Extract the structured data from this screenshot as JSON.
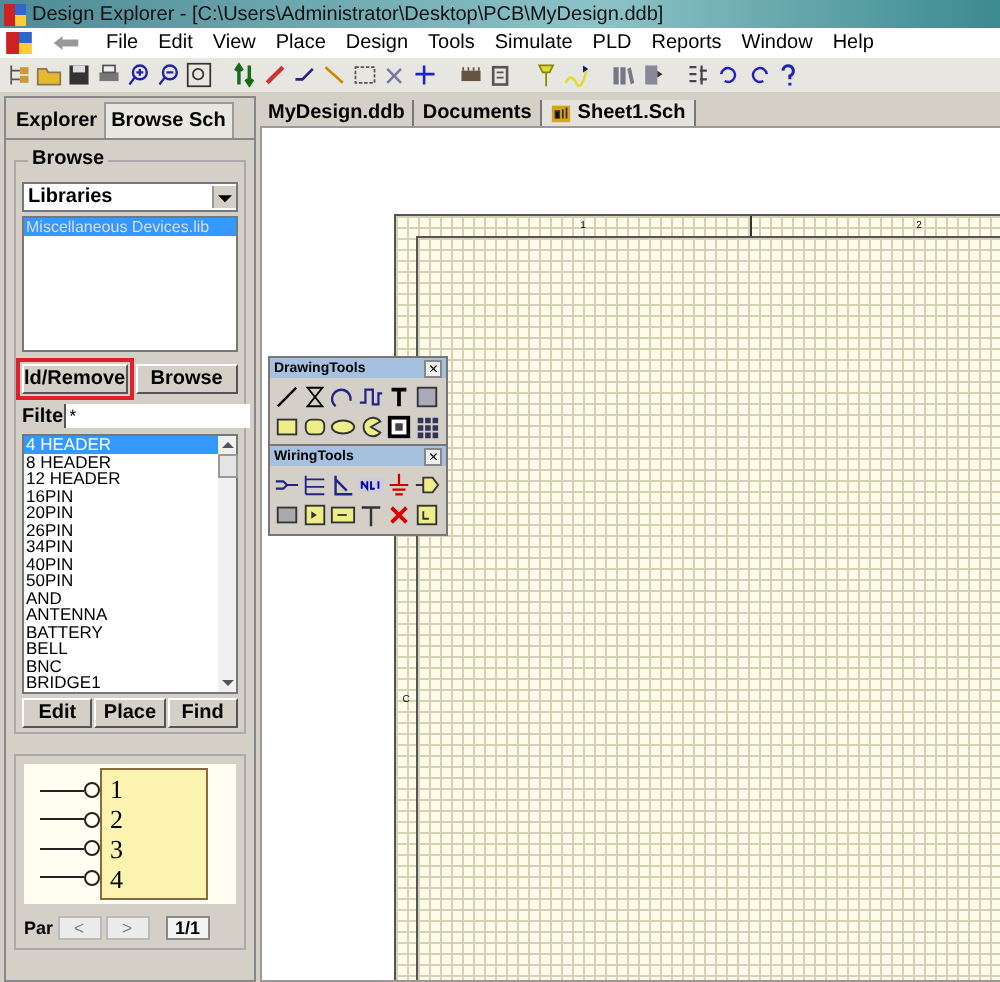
{
  "window": {
    "title": "Design Explorer - [C:\\Users\\Administrator\\Desktop\\PCB\\MyDesign.ddb]"
  },
  "menu": [
    "File",
    "Edit",
    "View",
    "Place",
    "Design",
    "Tools",
    "Simulate",
    "PLD",
    "Reports",
    "Window",
    "Help"
  ],
  "panel_tabs": [
    {
      "label": "Explorer",
      "selected": false
    },
    {
      "label": "Browse Sch",
      "selected": true
    }
  ],
  "browse": {
    "title": "Browse",
    "dropdown": "Libraries",
    "libraries": [
      {
        "label": "Miscellaneous Devices.lib",
        "selected": true
      }
    ],
    "buttons": [
      {
        "label": "ld/Remove",
        "highlighted": true
      },
      {
        "label": "Browse",
        "highlighted": false
      }
    ],
    "filter_label": "Filte",
    "filter_value": "*",
    "components": [
      {
        "label": "4 HEADER",
        "selected": true
      },
      {
        "label": "8 HEADER",
        "selected": false
      },
      {
        "label": "12 HEADER",
        "selected": false
      },
      {
        "label": "16PIN",
        "selected": false
      },
      {
        "label": "20PIN",
        "selected": false
      },
      {
        "label": "26PIN",
        "selected": false
      },
      {
        "label": "34PIN",
        "selected": false
      },
      {
        "label": "40PIN",
        "selected": false
      },
      {
        "label": "50PIN",
        "selected": false
      },
      {
        "label": "AND",
        "selected": false
      },
      {
        "label": "ANTENNA",
        "selected": false
      },
      {
        "label": "BATTERY",
        "selected": false
      },
      {
        "label": "BELL",
        "selected": false
      },
      {
        "label": "BNC",
        "selected": false
      },
      {
        "label": "BRIDGE1",
        "selected": false
      }
    ],
    "component_buttons": [
      "Edit",
      "Place",
      "Find"
    ]
  },
  "preview": {
    "pins": [
      "1",
      "2",
      "3",
      "4"
    ],
    "part_label": "Par",
    "prev": "<",
    "next": ">",
    "page": "1/1"
  },
  "doc_tabs": [
    {
      "label": "MyDesign.ddb",
      "selected": false,
      "icon": false
    },
    {
      "label": "Documents",
      "selected": false,
      "icon": false
    },
    {
      "label": "Sheet1.Sch",
      "selected": true,
      "icon": true
    }
  ],
  "sheet": {
    "column_marks": [
      "1",
      "2"
    ],
    "row_mark": "C"
  },
  "floating_toolbars": [
    {
      "title": "DrawingTools",
      "close": "×",
      "kind": "drawing"
    },
    {
      "title": "WiringTools",
      "close": "×",
      "kind": "wiring"
    }
  ]
}
